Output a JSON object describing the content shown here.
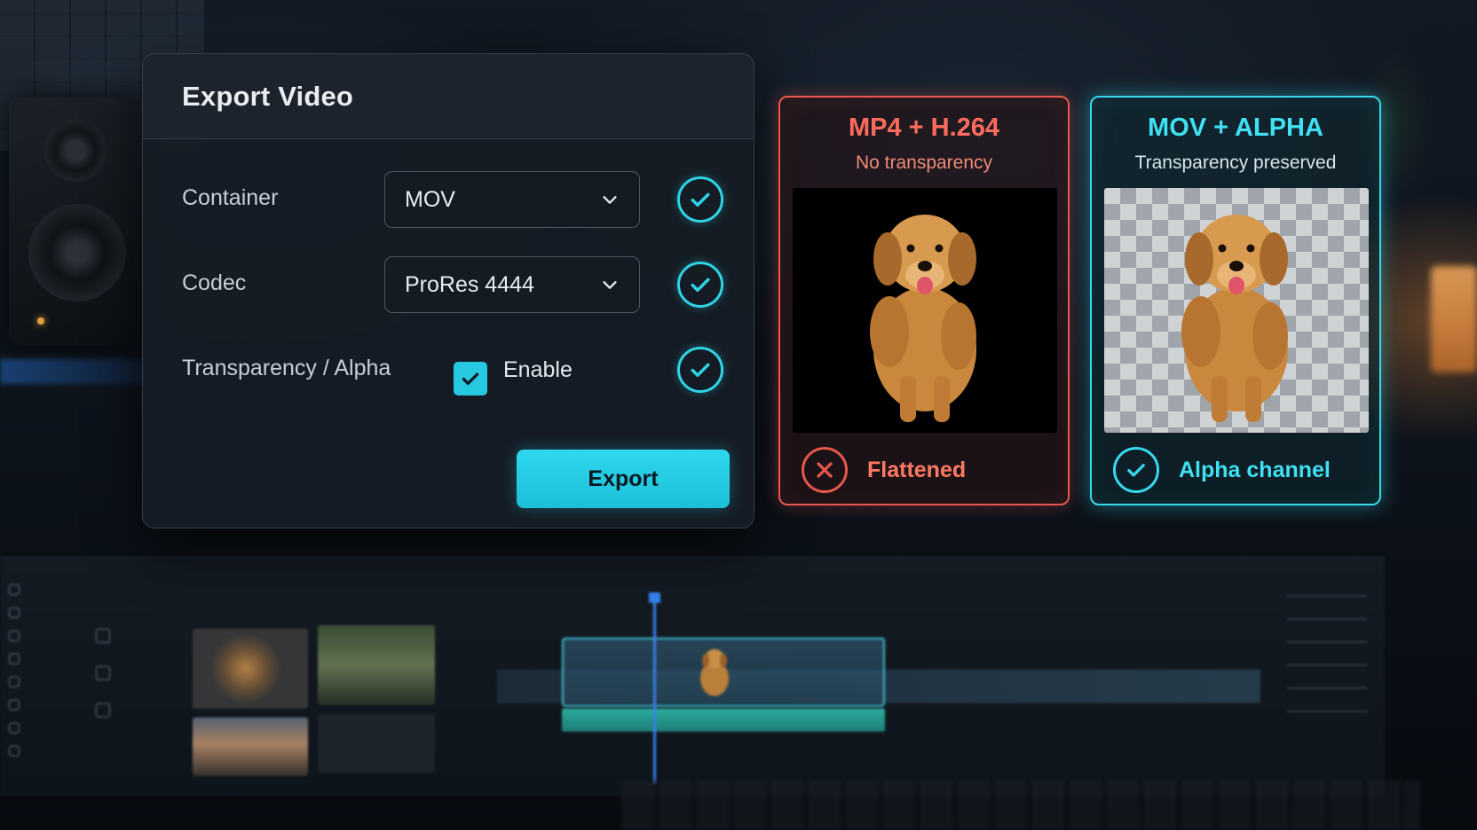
{
  "dialog": {
    "title": "Export Video",
    "container": {
      "label": "Container",
      "value": "MOV"
    },
    "codec": {
      "label": "Codec",
      "value": "ProRes 4444"
    },
    "transparency": {
      "label": "Transparency / Alpha",
      "checkbox_label": "Enable",
      "checked": true
    },
    "export_label": "Export"
  },
  "cards": {
    "flattened": {
      "title": "MP4 + H.264",
      "subtitle": "No transparency",
      "status": "Flattened",
      "status_icon": "x-circle-icon",
      "color": "#e8574b"
    },
    "alpha": {
      "title": "MOV + ALPHA",
      "subtitle": "Transparency preserved",
      "status": "Alpha channel",
      "status_icon": "check-circle-icon",
      "color": "#37d9ec"
    }
  },
  "colors": {
    "accent": "#2fd3e6",
    "error": "#e8574b",
    "panel": "#161c24"
  }
}
